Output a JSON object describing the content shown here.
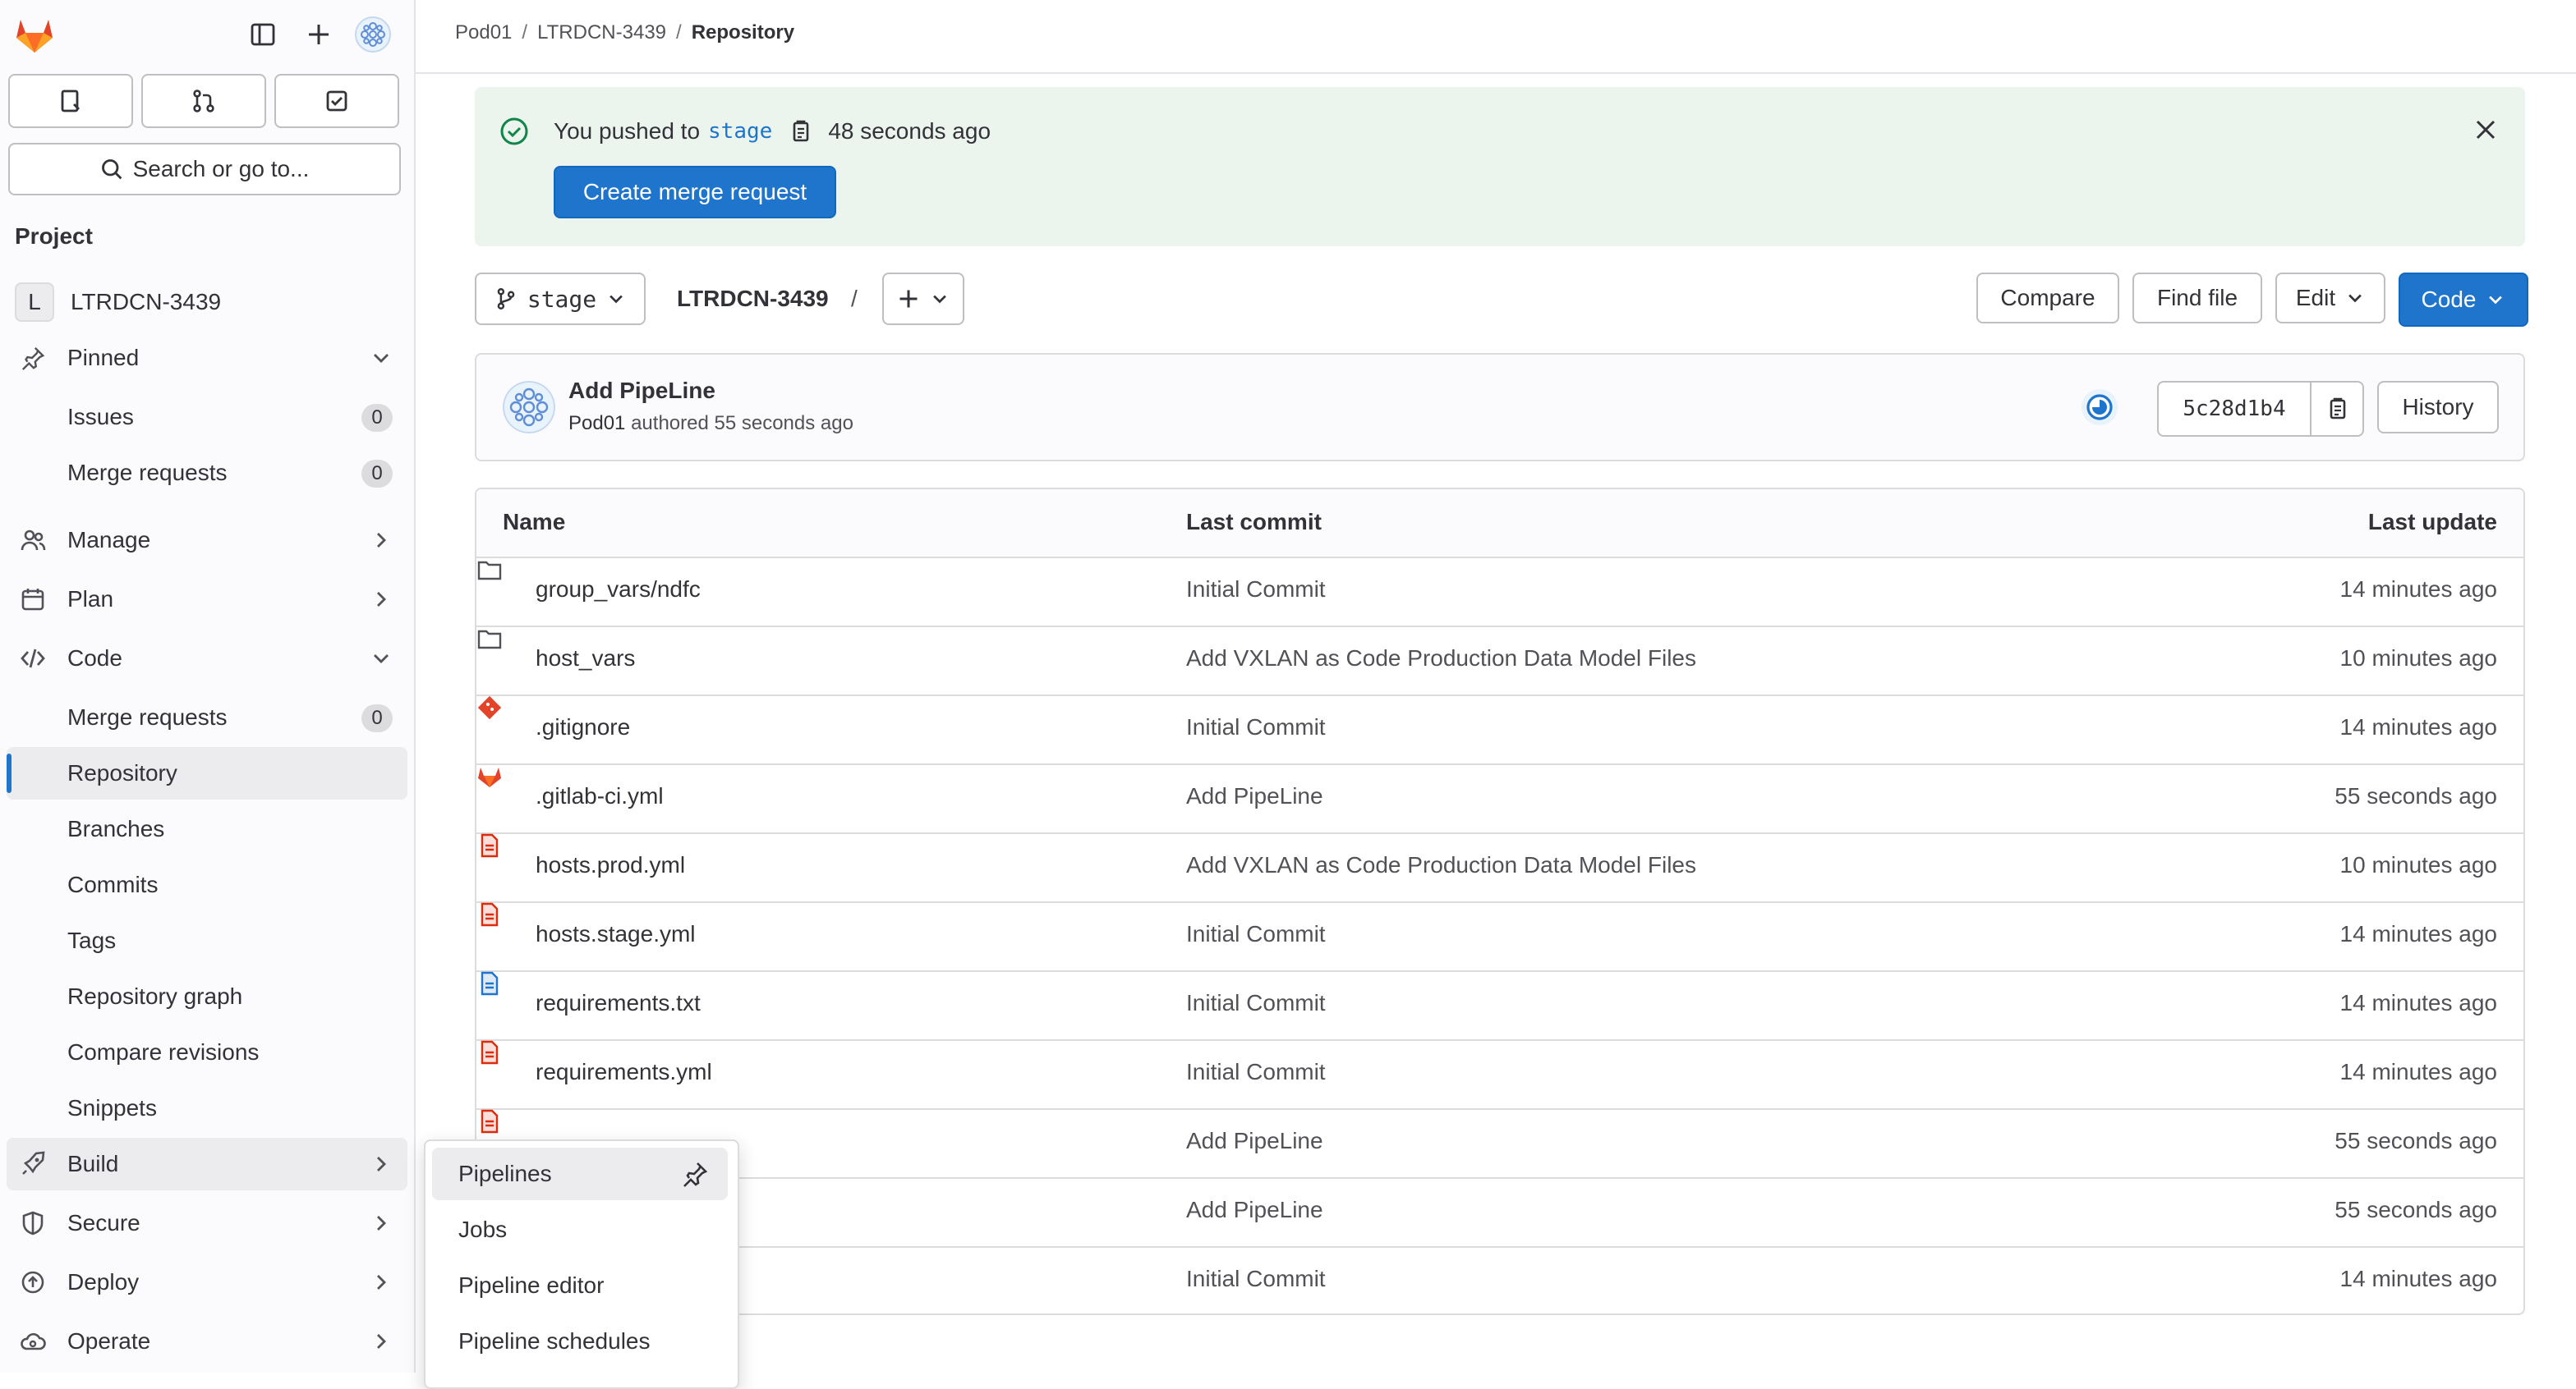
{
  "breadcrumb": {
    "items": [
      "Pod01",
      "LTRDCN-3439",
      "Repository"
    ]
  },
  "sidebar": {
    "search_label": "Search or go to...",
    "section_title": "Project",
    "project": {
      "initial": "L",
      "name": "LTRDCN-3439"
    },
    "pinned": {
      "label": "Pinned",
      "items": [
        {
          "label": "Issues",
          "count": "0"
        },
        {
          "label": "Merge requests",
          "count": "0"
        }
      ]
    },
    "manage": "Manage",
    "plan": "Plan",
    "code": {
      "label": "Code",
      "items": [
        {
          "label": "Merge requests",
          "count": "0"
        },
        {
          "label": "Repository"
        },
        {
          "label": "Branches"
        },
        {
          "label": "Commits"
        },
        {
          "label": "Tags"
        },
        {
          "label": "Repository graph"
        },
        {
          "label": "Compare revisions"
        },
        {
          "label": "Snippets"
        }
      ]
    },
    "build": "Build",
    "secure": "Secure",
    "deploy": "Deploy",
    "operate": "Operate"
  },
  "alert": {
    "prefix": "You pushed to",
    "branch": "stage",
    "time": "48 seconds ago",
    "button": "Create merge request",
    "status_color": "#108548"
  },
  "toolbar": {
    "branch": "stage",
    "project_path": "LTRDCN-3439",
    "path_sep": "/",
    "compare": "Compare",
    "find_file": "Find file",
    "edit": "Edit",
    "code": "Code"
  },
  "commit": {
    "title": "Add PipeLine",
    "author": "Pod01",
    "authored_text": "authored 55 seconds ago",
    "sha": "5c28d1b4",
    "history": "History"
  },
  "files": {
    "headers": {
      "name": "Name",
      "last_commit": "Last commit",
      "last_update": "Last update"
    },
    "rows": [
      {
        "name": "group_vars/ndfc",
        "icon": "folder-icon",
        "commit": "Initial Commit",
        "updated": "14 minutes ago"
      },
      {
        "name": "host_vars",
        "icon": "folder-icon",
        "commit": "Add VXLAN as Code Production Data Model Files",
        "updated": "10 minutes ago"
      },
      {
        "name": ".gitignore",
        "icon": "git-icon",
        "commit": "Initial Commit",
        "updated": "14 minutes ago"
      },
      {
        "name": ".gitlab-ci.yml",
        "icon": "gitlab-icon",
        "commit": "Add PipeLine",
        "updated": "55 seconds ago"
      },
      {
        "name": "hosts.prod.yml",
        "icon": "yaml-file-icon",
        "commit": "Add VXLAN as Code Production Data Model Files",
        "updated": "10 minutes ago"
      },
      {
        "name": "hosts.stage.yml",
        "icon": "yaml-file-icon",
        "commit": "Initial Commit",
        "updated": "14 minutes ago"
      },
      {
        "name": "requirements.txt",
        "icon": "text-file-icon",
        "commit": "Initial Commit",
        "updated": "14 minutes ago"
      },
      {
        "name": "requirements.yml",
        "icon": "yaml-file-icon",
        "commit": "Initial Commit",
        "updated": "14 minutes ago"
      },
      {
        "name": "",
        "icon": "yaml-file-icon",
        "commit": "Add PipeLine",
        "updated": "55 seconds ago"
      },
      {
        "name": "",
        "icon": "",
        "commit": "Add PipeLine",
        "updated": "55 seconds ago"
      },
      {
        "name": "",
        "icon": "",
        "commit": "Initial Commit",
        "updated": "14 minutes ago"
      }
    ]
  },
  "build_flyout": {
    "items": [
      "Pipelines",
      "Jobs",
      "Pipeline editor",
      "Pipeline schedules"
    ]
  },
  "colors": {
    "accent": "#1f75cb",
    "alert_bg": "#ecf4ee",
    "sidebar_bg": "#fbfafd"
  }
}
